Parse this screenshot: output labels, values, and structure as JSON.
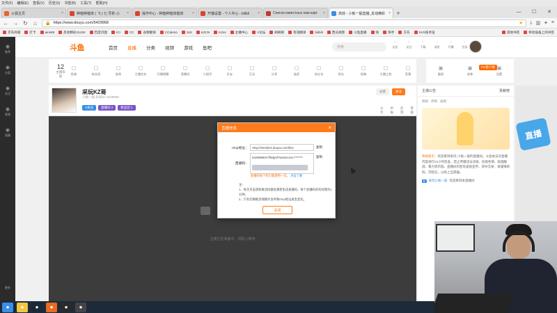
{
  "browser": {
    "menu": [
      "文件(F)",
      "编辑(E)",
      "查看(V)",
      "历史(S)",
      "书签(B)",
      "工具(T)",
      "帮助(H)"
    ],
    "tabs": [
      {
        "label": "火狐主页",
        "color": "#e8632a",
        "active": false
      },
      {
        "label": "种植种植体 ( 飞 ) 七 牙析-小",
        "color": "#d9442f",
        "active": false
      },
      {
        "label": "操作中心 - 种植种植体植体",
        "color": "#d9442f",
        "active": false
      },
      {
        "label": "开播设置 - 个人中心 - bilibil",
        "color": "#d9442f",
        "active": false
      },
      {
        "label": "Список известных нам карт",
        "color": "#c0392b",
        "active": false
      },
      {
        "label": "高效 - 小板一般直播_反动精彩",
        "color": "#3a8ee6",
        "active": true
      }
    ],
    "new_tab": "+",
    "url": "https://www.douyu.com/5429968",
    "bookmarks": [
      "京东商城",
      "打卡",
      "ains99",
      "反动精彩OUSE",
      "百度识图",
      "ICI",
      "CC",
      "谷歌翻译",
      "CCdemo",
      "342",
      "KZCN",
      "KZxs",
      "主播中心",
      "X论坛",
      "刷刷刷",
      "有道翻译",
      "bilibili",
      "西瓜视频",
      "斗鱼直播",
      "快",
      "快手",
      "方氏",
      "SVS技术设",
      "其他书签",
      "移动设备上的书签"
    ]
  },
  "site": {
    "left_nav": [
      {
        "icon": "home-icon",
        "label": "推荐"
      },
      {
        "icon": "grid-icon",
        "label": "分类"
      },
      {
        "icon": "heart-icon",
        "label": "关注"
      },
      {
        "icon": "play-icon",
        "label": "视频"
      },
      {
        "icon": "bell-icon",
        "label": "直播"
      }
    ],
    "left_nav_bottom": "更多",
    "logo": "斗鱼",
    "main_nav": [
      {
        "label": "首页",
        "on": false
      },
      {
        "label": "直播",
        "on": true
      },
      {
        "label": "分类",
        "on": false
      },
      {
        "label": "视频",
        "on": false
      },
      {
        "label": "游戏",
        "on": false
      },
      {
        "label": "鱼吧",
        "on": false
      }
    ],
    "search_placeholder": "搜索",
    "top_icons": [
      "历史",
      "关注",
      "下载",
      "消息",
      "开播",
      "任务"
    ],
    "category_count": {
      "number": "12",
      "label": "主播等级"
    },
    "categories": [
      "鱼翅",
      "粉丝团",
      "勋章",
      "主播任务",
      "开播提醒",
      "直播间",
      "小程序",
      "好友",
      "互动",
      "分享",
      "抽奖",
      "发红包",
      "鱼丸",
      "投稿",
      "主播工具",
      "竞猜"
    ],
    "categories_right": [
      "截屏",
      "录像",
      "设置"
    ],
    "pc_badge": "PC客户端",
    "anchor": {
      "name": "采玩KZ哥",
      "meta": "小板一般    房间ID: 5429968",
      "tags": [
        {
          "label": "V关注",
          "color": "#3a8ee6"
        },
        {
          "label": "直播间 2",
          "color": "#7b53c9"
        },
        {
          "label": "粉丝团 1",
          "color": "#7b53c9"
        }
      ],
      "right_buttons": [
        {
          "label": "分享",
          "bg": "#f1f1f1",
          "fg": "#666"
        },
        {
          "label": "关注",
          "bg": "#ff7a1a",
          "fg": "#fff"
        }
      ],
      "stats": [
        "分享",
        "举报",
        "反馈",
        "客服"
      ]
    },
    "player_notice": "主播正在准备中，请耐心等待",
    "sidebar": {
      "head_left": "主播公告",
      "head_right": "贡献榜",
      "tabs": [
        "周榜",
        "月榜",
        "总榜"
      ],
      "notice_title": "系统提示：",
      "notice": "欢迎来到采玩·小板一般的直播间。斗鱼依法对直播内容进行24小时巡查，禁止传播违法违规、低俗色情、吸烟酗酒、暴力等内容。直播间内若有虚假宣传、诱导交易、请谨慎辨别，勿轻信，以防上当受骗。",
      "user_lv": "5",
      "user_name": "采玩小板一般",
      "user_text": "欢迎来到本直播间"
    }
  },
  "modal": {
    "title": "直播信息",
    "close": "×",
    "rtmp_label": "rtmp地址：",
    "rtmp_value": "rtmp://sendtc3.douyu.com/live",
    "copy1": "复制",
    "key_label": "直播码：",
    "key_value": "5429968rH7f6dpsf?wsSecret=*******",
    "copy2": "复制",
    "tip": "直播码每个码只能使用一次。",
    "tip_link": "点击了解",
    "notes_title": "注：",
    "note1": "1、每次点击获取推流码都会重新生成直播码，每个直播码的有效期为1分钟。",
    "note2": "2、只有切换推流线路才会导致rtmp地址发生变化。",
    "button": "关闭"
  },
  "taskbar": [
    {
      "icon": "windows-icon",
      "color": "#3a8ee6"
    },
    {
      "icon": "explorer-icon",
      "color": "#f4c542"
    },
    {
      "icon": "steam-icon",
      "color": "#1b2838"
    },
    {
      "icon": "firefox-icon",
      "color": "#e86b1f"
    },
    {
      "icon": "game-icon",
      "color": "#2a2a2a"
    },
    {
      "icon": "obs-icon",
      "color": "#444"
    }
  ],
  "rail_badge": "直播"
}
